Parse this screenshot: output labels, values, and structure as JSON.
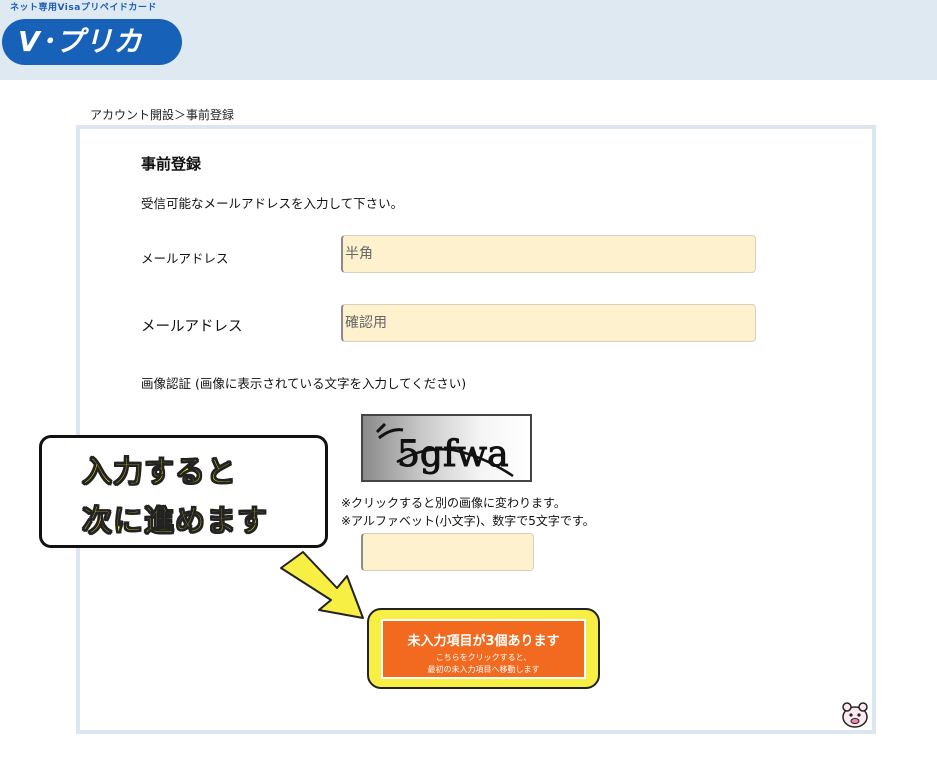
{
  "header": {
    "tagline": "ネット専用Visaプリペイドカード",
    "logo": "V･プリカ"
  },
  "breadcrumb": "アカウント開設＞事前登録",
  "form": {
    "title": "事前登録",
    "intro": "受信可能なメールアドレスを入力して下さい。",
    "email_label": "メールアドレス",
    "email_placeholder": "半角",
    "email_confirm_label": "メールアドレス",
    "email_confirm_placeholder": "確認用",
    "captcha_label": "画像認証 (画像に表示されている文字を入力してください)",
    "captcha_text": "5gfwa",
    "captcha_note1": "※クリックすると別の画像に変わります。",
    "captcha_note2": "※アルファベット(小文字)、数字で5文字です。",
    "captcha_value": ""
  },
  "callout": {
    "line1": "入力すると",
    "line2": "次に進めます"
  },
  "submit": {
    "main": "未入力項目が3個あります",
    "sub1": "こちらをクリックすると、",
    "sub2": "最初の未入力項目へ移動します"
  },
  "colors": {
    "header_bg": "#dfe9f2",
    "logo_bg": "#1762b8",
    "field_bg": "#fef1cd",
    "button_orange": "#f26a1f",
    "highlight_yellow": "#f7ef43"
  }
}
